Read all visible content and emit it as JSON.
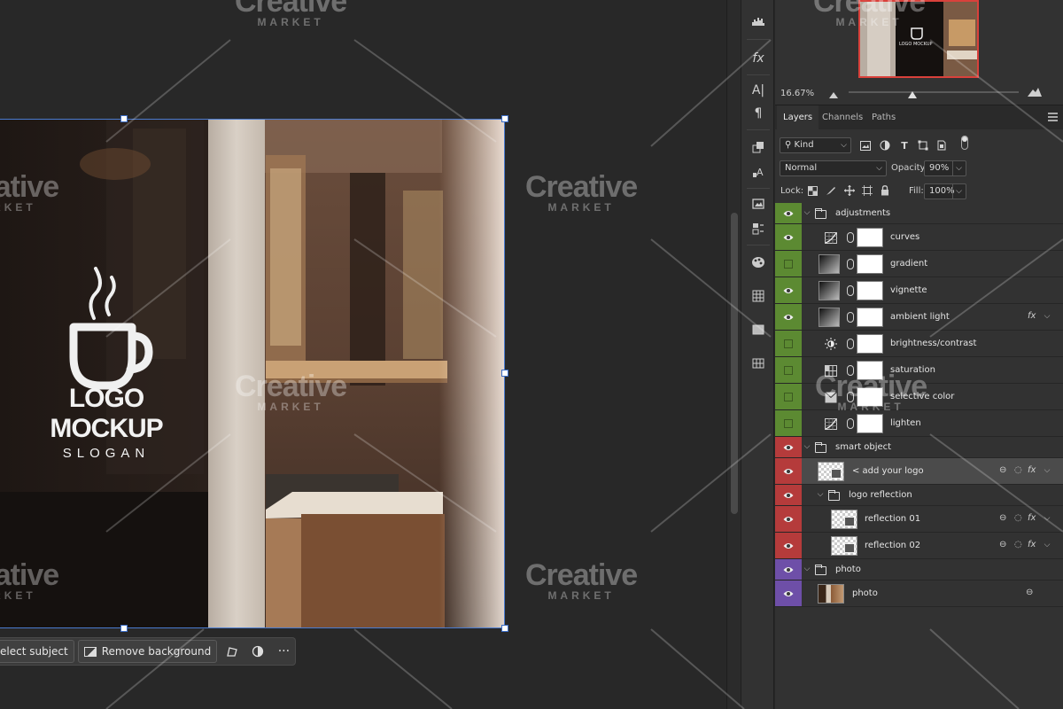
{
  "canvas": {
    "logo_title": "LOGO MOCKUP",
    "logo_slogan": "SLOGAN"
  },
  "taskbar": {
    "select_subject": "elect subject",
    "remove_background": "Remove background",
    "more": "···"
  },
  "watermark": {
    "line1": "Creative",
    "line2": "MARKET"
  },
  "navigator": {
    "zoom": "16.67%",
    "thumb_text": "LOGO MOCKUP"
  },
  "tabs": {
    "layers": "Layers",
    "channels": "Channels",
    "paths": "Paths"
  },
  "layer_controls": {
    "filter_kind": "Kind",
    "blend_mode": "Normal",
    "opacity_label": "Opacity:",
    "opacity_value": "90%",
    "lock_label": "Lock:",
    "fill_label": "Fill:",
    "fill_value": "100%"
  },
  "colors": {
    "green": "#5c8a32",
    "red": "#b53b3b",
    "purple": "#6e4fa8",
    "selection": "#4a7bd0"
  },
  "layers": [
    {
      "name": "adjustments",
      "type": "group",
      "color": "green",
      "visible": true
    },
    {
      "name": "curves",
      "type": "adj",
      "icon": "curves-icon",
      "color": "green",
      "visible": true
    },
    {
      "name": "gradient",
      "type": "grad",
      "color": "green",
      "visible": false
    },
    {
      "name": "vignette",
      "type": "grad",
      "color": "green",
      "visible": true
    },
    {
      "name": "ambient light",
      "type": "grad",
      "color": "green",
      "visible": true,
      "fx": "fx"
    },
    {
      "name": "brightness/contrast",
      "type": "adj",
      "icon": "brightness-icon",
      "color": "green",
      "visible": false
    },
    {
      "name": "saturation",
      "type": "adj",
      "icon": "hue-saturation-icon",
      "color": "green",
      "visible": false
    },
    {
      "name": "selective color",
      "type": "adj",
      "icon": "selective-color-icon",
      "color": "green",
      "visible": false
    },
    {
      "name": "lighten",
      "type": "adj",
      "icon": "curves-icon",
      "color": "green",
      "visible": false
    },
    {
      "name": "smart object",
      "type": "group",
      "color": "red",
      "visible": true
    },
    {
      "name": "< add your logo",
      "type": "smart",
      "color": "red",
      "visible": true,
      "fx": "fx",
      "selected": true
    },
    {
      "name": "logo reflection",
      "type": "group",
      "color": "red",
      "visible": true
    },
    {
      "name": "reflection 01",
      "type": "smart",
      "color": "red",
      "visible": true,
      "fx": "fx"
    },
    {
      "name": "reflection 02",
      "type": "smart",
      "color": "red",
      "visible": true,
      "fx": "fx"
    },
    {
      "name": "photo",
      "type": "group",
      "color": "purple",
      "visible": true
    },
    {
      "name": "photo",
      "type": "photo",
      "color": "purple",
      "visible": true
    }
  ]
}
